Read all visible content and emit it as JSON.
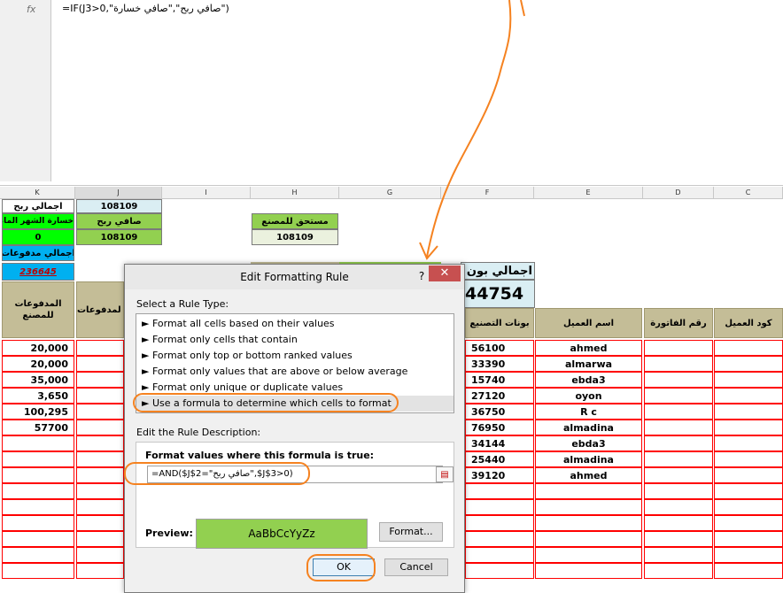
{
  "formula_bar": {
    "fx_label": "fx",
    "formula": "=IF(J3>0,\"صافي ربح\",\"صافي خسارة\")"
  },
  "columns": [
    "K",
    "J",
    "I",
    "H",
    "G",
    "F",
    "E",
    "D",
    "C"
  ],
  "top_cells": {
    "k1": "اجمالي ربح",
    "j1": "108109",
    "k2": "خسارة الشهر الماضي",
    "j2": "صافي ربح",
    "h2": "مستحق للمصنع",
    "k3": "0",
    "j3": "108109",
    "h3": "108109",
    "k4": "اجمالي مدفوعات",
    "k5": "236645",
    "f_title": "اجمالي بون تع",
    "f_total": "44754"
  },
  "headers": {
    "k": "المدفوعات للمصنع",
    "j": "لمدفوعات",
    "f": "بونات التصنيع",
    "e": "اسم العميل",
    "d": "رقم الفاتورة",
    "c": "كود العميل"
  },
  "rows": [
    {
      "k": "20,000",
      "f": "56100",
      "e": "ahmed"
    },
    {
      "k": "20,000",
      "f": "33390",
      "e": "almarwa"
    },
    {
      "k": "35,000",
      "f": "15740",
      "e": "ebda3"
    },
    {
      "k": "3,650",
      "f": "27120",
      "e": "oyon"
    },
    {
      "k": "100,295",
      "f": "36750",
      "e": "R c"
    },
    {
      "k": "57700",
      "f": "76950",
      "e": "almadina"
    },
    {
      "k": "",
      "f": "34144",
      "e": "ebda3"
    },
    {
      "k": "",
      "f": "25440",
      "e": "almadina"
    },
    {
      "k": "",
      "f": "39120",
      "e": "ahmed"
    },
    {
      "k": "",
      "f": "",
      "e": ""
    },
    {
      "k": "",
      "f": "",
      "e": ""
    },
    {
      "k": "",
      "f": "",
      "e": ""
    },
    {
      "k": "",
      "f": "",
      "e": ""
    },
    {
      "k": "",
      "f": "",
      "e": ""
    },
    {
      "k": "",
      "f": "",
      "e": ""
    }
  ],
  "dialog": {
    "title": "Edit Formatting Rule",
    "help": "?",
    "close": "✕",
    "select_label": "Select a Rule Type:",
    "rule_types": [
      "Format all cells based on their values",
      "Format only cells that contain",
      "Format only top or bottom ranked values",
      "Format only values that are above or below average",
      "Format only unique or duplicate values",
      "Use a formula to determine which cells to format"
    ],
    "edit_label": "Edit the Rule Description:",
    "formula_label": "Format values where this formula is true:",
    "formula_value": "=AND($J$2=\"صافي ربح\",$J$3>0)",
    "preview_label": "Preview:",
    "preview_text": "AaBbCcYyZz",
    "format_button": "Format...",
    "ok_button": "OK",
    "cancel_button": "Cancel"
  },
  "colors": {
    "accent_green": "#92d050",
    "annotation_orange": "#f58220",
    "header_tan": "#c4bd97",
    "close_red": "#c75050"
  }
}
